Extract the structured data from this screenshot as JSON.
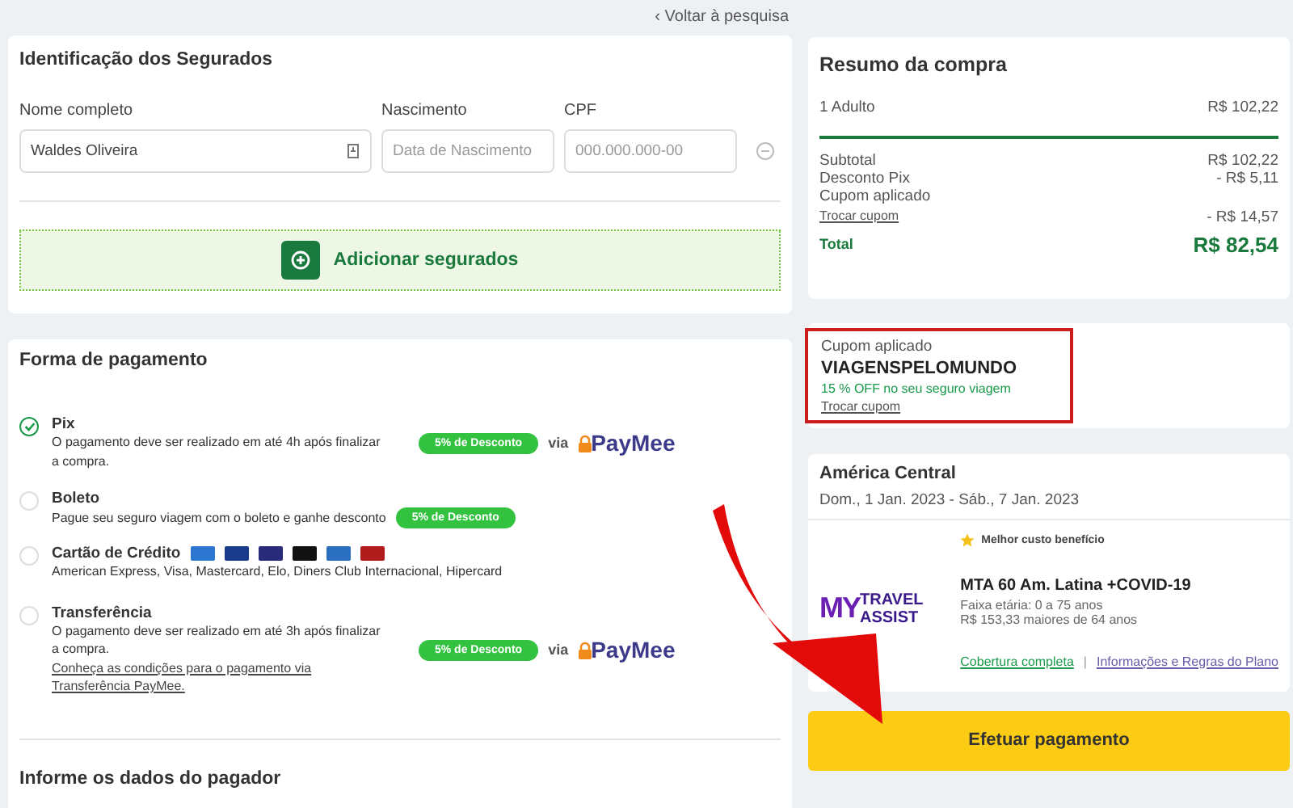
{
  "back_link": "‹ Voltar à pesquisa",
  "insured": {
    "title": "Identificação dos Segurados",
    "fields": [
      {
        "label": "Nome completo",
        "value": "Waldes Oliveira"
      },
      {
        "label": "Nascimento",
        "placeholder": "Data de Nascimento"
      },
      {
        "label": "CPF",
        "placeholder": "000.000.000-00"
      }
    ],
    "add_button": "Adicionar segurados"
  },
  "payment": {
    "title": "Forma de pagamento",
    "methods": [
      {
        "kind": "pix",
        "title": "Pix",
        "description": "O pagamento deve ser realizado em até 4h após finalizar a compra.",
        "badge": "5% de Desconto",
        "via": "via",
        "provider": "PayMee",
        "selected": true
      },
      {
        "kind": "boleto",
        "title": "Boleto",
        "description": "Pague seu seguro viagem com o boleto e ganhe desconto",
        "badge": "5% de Desconto",
        "selected": false
      },
      {
        "kind": "card",
        "title": "Cartão de Crédito",
        "description": "American Express, Visa, Mastercard, Elo, Diners Club Internacional, Hipercard",
        "selected": false
      },
      {
        "kind": "transfer",
        "title": "Transferência",
        "description": "O pagamento deve ser realizado em até 3h após finalizar a compra.",
        "link": "Conheça as condições para o pagamento via Transferência PayMee.",
        "badge": "5% de Desconto",
        "via": "via",
        "provider": "PayMee",
        "selected": false
      }
    ],
    "payer_title": "Informe os dados do pagador"
  },
  "summary": {
    "title": "Resumo da compra",
    "item": {
      "label": "1 Adulto",
      "value": "R$ 102,22"
    },
    "lines": [
      {
        "label": "Subtotal",
        "value": "R$ 102,22"
      },
      {
        "label": "Desconto Pix",
        "value": "- R$ 5,11"
      },
      {
        "label": "Cupom aplicado"
      },
      {
        "label": "Trocar cupom",
        "value": "- R$ 14,57",
        "kind": "link"
      }
    ],
    "total": {
      "label": "Total",
      "value": "R$ 82,54"
    }
  },
  "coupon": {
    "highlighted": true,
    "label": "Cupom aplicado",
    "code": "VIAGENSPELOMUNDO",
    "note": "15 % OFF no seu seguro viagem",
    "link": "Trocar cupom"
  },
  "plan": {
    "region": "América Central",
    "dates": "Dom., 1 Jan. 2023 - Sáb., 7 Jan. 2023",
    "logo": {
      "mark": "MY",
      "line1": "TRAVEL",
      "line2": "ASSIST"
    },
    "tag": "Melhor custo benefício",
    "name": "MTA 60 Am. Latina +COVID-19",
    "age": "Faixa etária: 0 a 75 anos",
    "price_note": "R$ 153,33 maiores de 64 anos",
    "links": [
      "Cobertura completa",
      "Informações e Regras do Plano"
    ],
    "separator": "|"
  },
  "pay_button": "Efetuar pagamento"
}
